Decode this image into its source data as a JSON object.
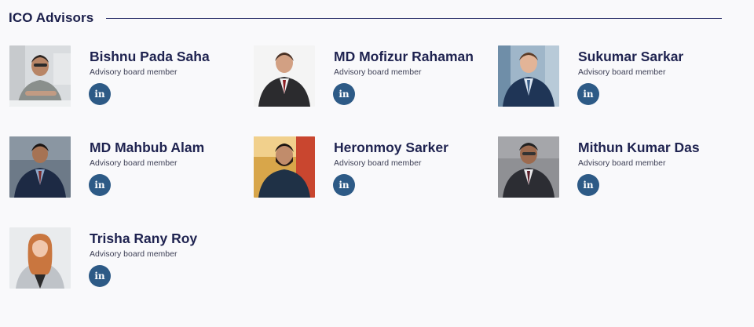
{
  "section": {
    "title": "ICO Advisors"
  },
  "advisors": [
    {
      "name": "Bishnu Pada Saha",
      "role": "Advisory board member",
      "social": "in",
      "social_icon": "linkedin-icon"
    },
    {
      "name": "MD Mofizur Rahaman",
      "role": "Advisory board member",
      "social": "in",
      "social_icon": "linkedin-icon"
    },
    {
      "name": "Sukumar Sarkar",
      "role": "Advisory board member",
      "social": "in",
      "social_icon": "linkedin-icon"
    },
    {
      "name": "MD Mahbub Alam",
      "role": "Advisory board member",
      "social": "in",
      "social_icon": "linkedin-icon"
    },
    {
      "name": "Heronmoy Sarker",
      "role": "Advisory board member",
      "social": "in",
      "social_icon": "linkedin-icon"
    },
    {
      "name": "Mithun Kumar Das",
      "role": "Advisory board member",
      "social": "in",
      "social_icon": "linkedin-icon"
    },
    {
      "name": "Trisha Rany Roy",
      "role": "Advisory board member",
      "social": "in",
      "social_icon": "linkedin-icon"
    }
  ],
  "colors": {
    "heading": "#1b1f4b",
    "rule": "#2a2f6a",
    "name": "#1f2350",
    "linkedin_button": "#2d5a86",
    "background": "#f9f9fb"
  }
}
